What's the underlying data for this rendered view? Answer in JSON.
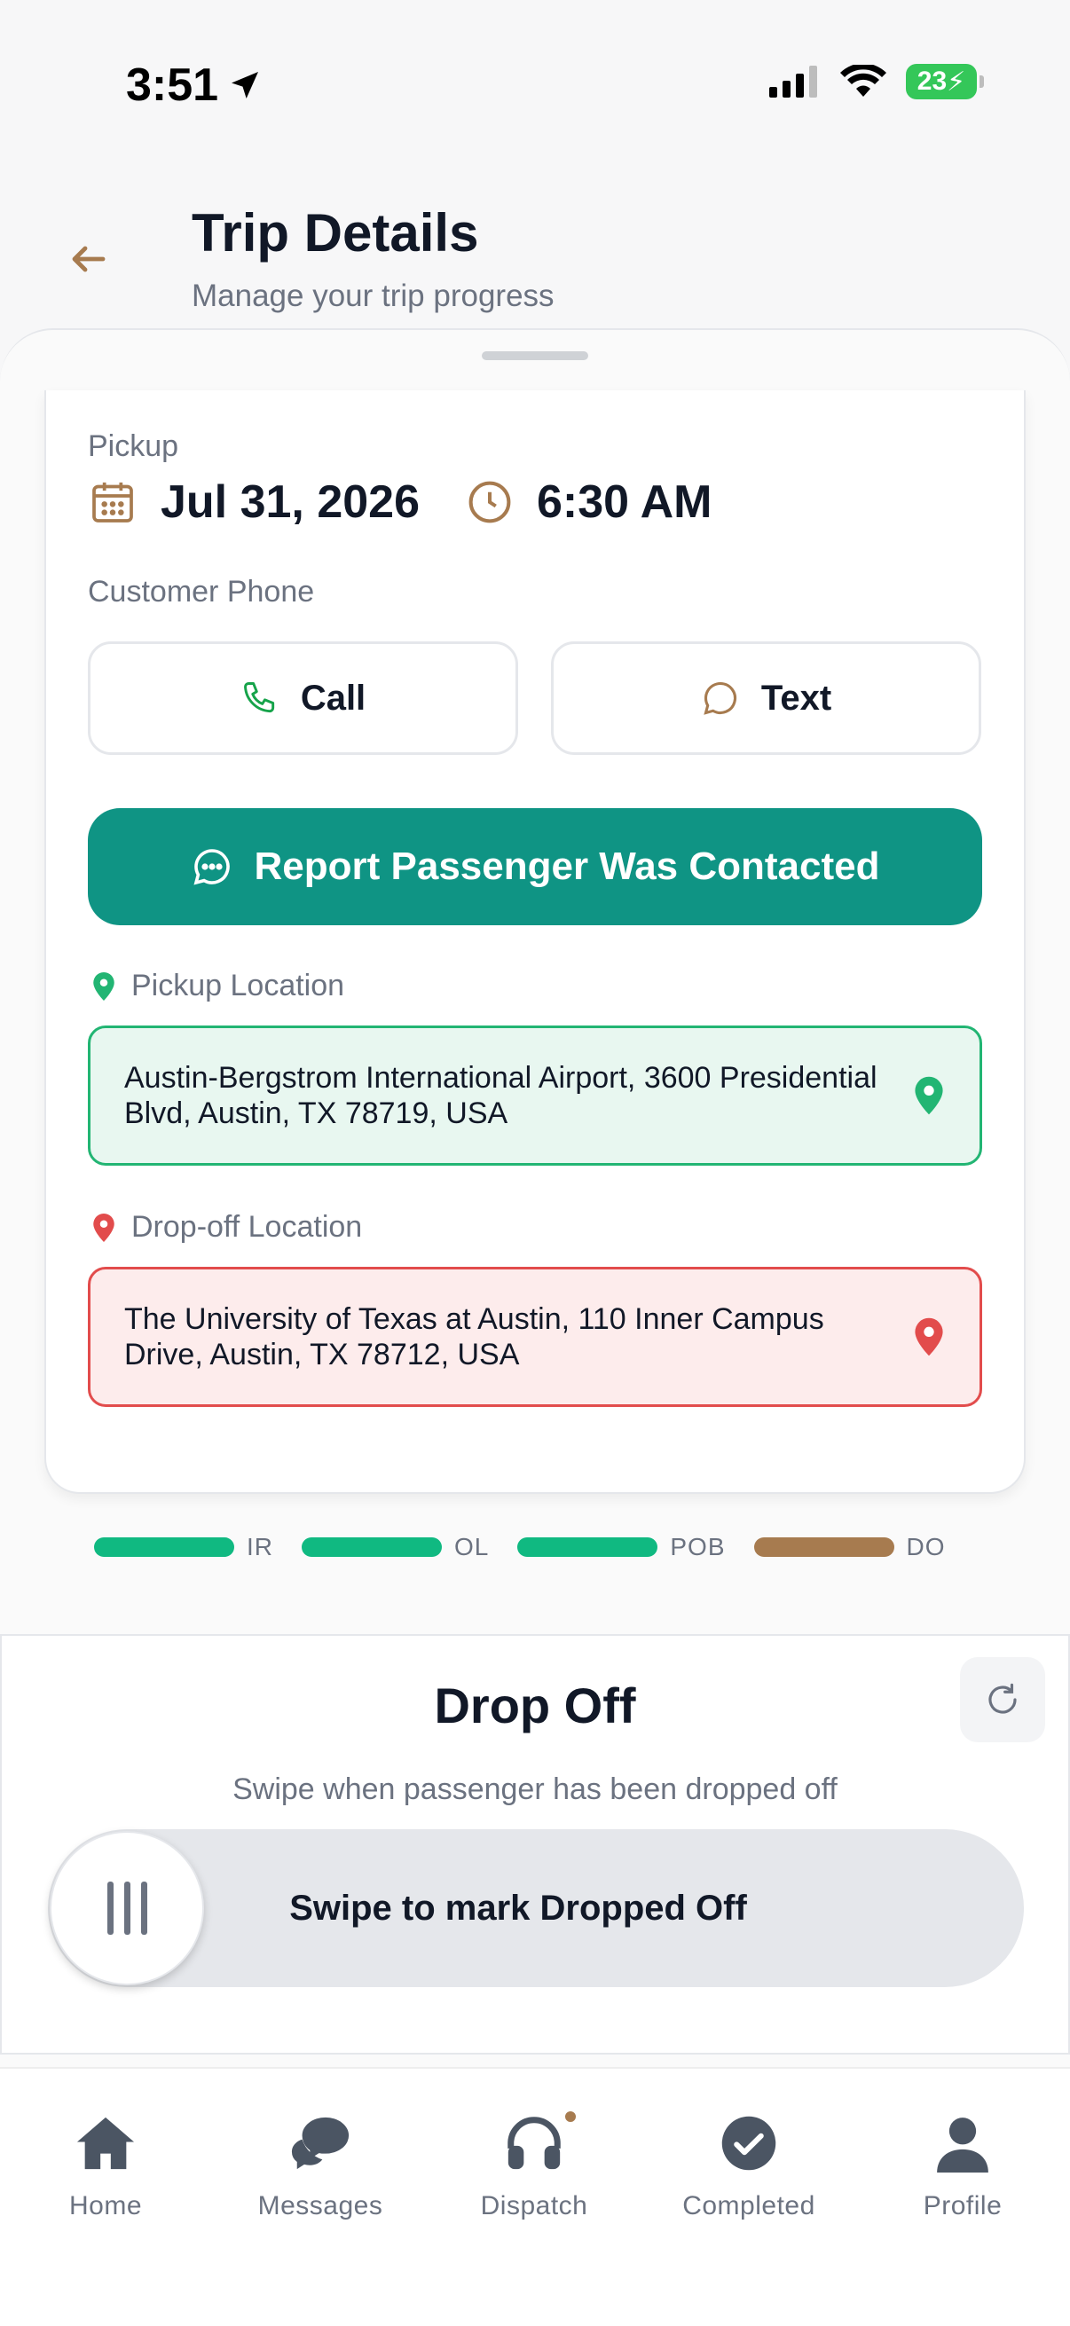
{
  "status_bar": {
    "time": "3:51",
    "battery": "23"
  },
  "header": {
    "title": "Trip Details",
    "subtitle": "Manage your trip progress"
  },
  "pickup": {
    "label": "Pickup",
    "date": "Jul 31, 2026",
    "time": "6:30 AM"
  },
  "customer_phone": {
    "label": "Customer Phone",
    "call_label": "Call",
    "text_label": "Text"
  },
  "report_button": {
    "label": "Report Passenger Was Contacted"
  },
  "pickup_location": {
    "label": "Pickup Location",
    "address": "Austin-Bergstrom International Airport, 3600 Presidential Blvd, Austin, TX 78719, USA"
  },
  "dropoff_location": {
    "label": "Drop-off Location",
    "address": "The University of Texas at Austin, 110 Inner Campus Drive, Austin, TX 78712, USA"
  },
  "progress": {
    "steps": [
      {
        "label": "IR",
        "color": "#10b981",
        "complete": true
      },
      {
        "label": "OL",
        "color": "#10b981",
        "complete": true
      },
      {
        "label": "POB",
        "color": "#10b981",
        "complete": true
      },
      {
        "label": "DO",
        "color": "#a77b4f",
        "complete": false
      }
    ]
  },
  "drop_off_panel": {
    "title": "Drop Off",
    "subtitle": "Swipe when passenger has been dropped off",
    "swipe_label": "Swipe to mark Dropped Off"
  },
  "tabbar": {
    "items": [
      {
        "label": "Home",
        "icon": "home-icon"
      },
      {
        "label": "Messages",
        "icon": "chat-bubbles-icon"
      },
      {
        "label": "Dispatch",
        "icon": "headset-icon",
        "badge": true
      },
      {
        "label": "Completed",
        "icon": "check-circle-icon"
      },
      {
        "label": "Profile",
        "icon": "person-icon"
      }
    ]
  },
  "colors": {
    "accent": "#0f9484",
    "brown": "#a77b4f",
    "green": "#22b573",
    "red": "#e24c4c"
  }
}
